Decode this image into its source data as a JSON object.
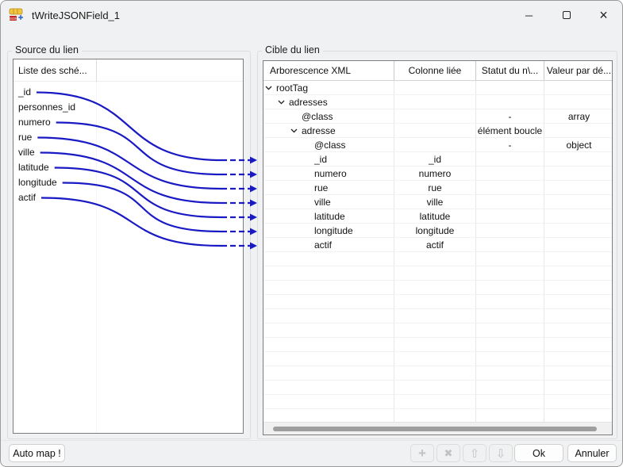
{
  "window": {
    "title": "tWriteJSONField_1"
  },
  "titlebar": {
    "controls": [
      {
        "name": "minimize",
        "glyph": "─"
      },
      {
        "name": "maximize",
        "glyph": ""
      },
      {
        "name": "close",
        "glyph": "×"
      }
    ]
  },
  "source_panel": {
    "title": "Source du lien",
    "schema_column_header": "Liste des sché...",
    "fields": [
      "_id",
      "personnes_id",
      "numero",
      "rue",
      "ville",
      "latitude",
      "longitude",
      "actif"
    ]
  },
  "target_panel": {
    "title": "Cible du lien",
    "columns": [
      "Arborescence XML",
      "Colonne liée",
      "Statut du n\\...",
      "Valeur par dé..."
    ],
    "rows": [
      {
        "label": "rootTag",
        "level": 0,
        "expanded": true,
        "linked_column": "",
        "status": "",
        "default_value": ""
      },
      {
        "label": "adresses",
        "level": 1,
        "expanded": true,
        "linked_column": "",
        "status": "",
        "default_value": ""
      },
      {
        "label": "@class",
        "level": 2,
        "expanded": false,
        "linked_column": "",
        "status": "-",
        "default_value": "array"
      },
      {
        "label": "adresse",
        "level": 2,
        "expanded": true,
        "linked_column": "",
        "status": "élément boucle",
        "default_value": ""
      },
      {
        "label": "@class",
        "level": 3,
        "expanded": false,
        "linked_column": "",
        "status": "-",
        "default_value": "object"
      },
      {
        "label": "_id",
        "level": 3,
        "expanded": false,
        "linked_column": "_id",
        "status": "",
        "default_value": ""
      },
      {
        "label": "numero",
        "level": 3,
        "expanded": false,
        "linked_column": "numero",
        "status": "",
        "default_value": ""
      },
      {
        "label": "rue",
        "level": 3,
        "expanded": false,
        "linked_column": "rue",
        "status": "",
        "default_value": ""
      },
      {
        "label": "ville",
        "level": 3,
        "expanded": false,
        "linked_column": "ville",
        "status": "",
        "default_value": ""
      },
      {
        "label": "latitude",
        "level": 3,
        "expanded": false,
        "linked_column": "latitude",
        "status": "",
        "default_value": ""
      },
      {
        "label": "longitude",
        "level": 3,
        "expanded": false,
        "linked_column": "longitude",
        "status": "",
        "default_value": ""
      },
      {
        "label": "actif",
        "level": 3,
        "expanded": false,
        "linked_column": "actif",
        "status": "",
        "default_value": ""
      }
    ],
    "empty_row_count": 12
  },
  "mappings": [
    {
      "source": "_id",
      "target": "_id"
    },
    {
      "source": "numero",
      "target": "numero"
    },
    {
      "source": "rue",
      "target": "rue"
    },
    {
      "source": "ville",
      "target": "ville"
    },
    {
      "source": "latitude",
      "target": "latitude"
    },
    {
      "source": "longitude",
      "target": "longitude"
    },
    {
      "source": "actif",
      "target": "actif"
    }
  ],
  "footer": {
    "auto_map": "Auto map !",
    "ok": "Ok",
    "cancel": "Annuler",
    "icon_buttons": [
      {
        "name": "add",
        "glyph": "+"
      },
      {
        "name": "delete",
        "glyph": "✖"
      },
      {
        "name": "move-up",
        "glyph": "⇧"
      },
      {
        "name": "move-down",
        "glyph": "⇩"
      }
    ]
  },
  "colors": {
    "mapping_line": "#1a1ac4",
    "panel_border": "#7d7d7d"
  }
}
